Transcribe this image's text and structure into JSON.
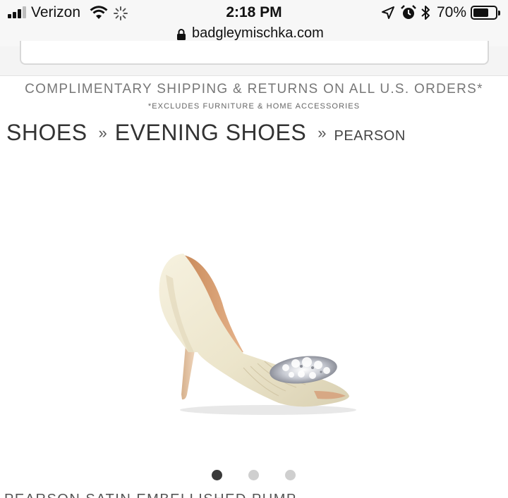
{
  "status_bar": {
    "carrier": "Verizon",
    "time": "2:18 PM",
    "battery_percent": "70%",
    "battery_level": 0.7,
    "icons": [
      "signal-icon",
      "wifi-icon",
      "activity-spinner-icon",
      "location-arrow-icon",
      "alarm-clock-icon",
      "bluetooth-icon",
      "battery-icon"
    ]
  },
  "browser": {
    "url": "badgleymischka.com",
    "secure_icon": "lock-icon"
  },
  "promo": {
    "main": "COMPLIMENTARY SHIPPING & RETURNS ON ALL U.S. ORDERS*",
    "sub": "*EXCLUDES FURNITURE & HOME ACCESSORIES"
  },
  "breadcrumb": {
    "items": [
      "SHOES",
      "EVENING SHOES",
      "PEARSON"
    ],
    "separator": "»"
  },
  "product": {
    "image": "ivory-satin-peep-toe-pump-with-crystal-brooch",
    "carousel": {
      "total": 3,
      "active_index": 0
    },
    "title_partial": "PEARSON SATIN EMBELLISHED PUMP"
  },
  "colors": {
    "text_dark": "#333333",
    "promo_gray": "#777777",
    "dot_active": "#3a3a3a",
    "dot_inactive": "#cfcfcf"
  }
}
